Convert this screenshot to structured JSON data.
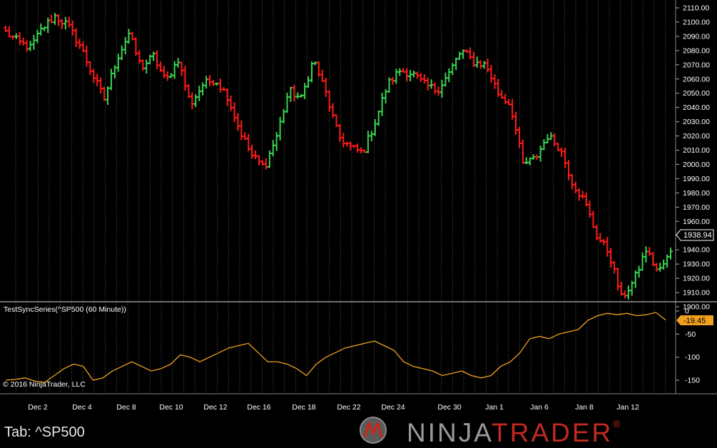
{
  "colors": {
    "background": "#000000",
    "up_bar": "#39d353",
    "down_bar": "#ff1a1a",
    "indicator_line": "#f0a020",
    "separator": "#dddddd",
    "grid": "#6a6a6a",
    "brand_red": "#c02a1f",
    "brand_gray": "#9a9a9a"
  },
  "price_panel": {
    "current_price_label": "1938.94"
  },
  "indicator_panel": {
    "title": "TestSyncSeries(^SP500 (60 Minute))",
    "current_value_label": "-19.45",
    "copyright": "© 2016 NinjaTrader, LLC"
  },
  "footer": {
    "tab_label": "Tab: ^SP500",
    "brand_ninja": "NINJA",
    "brand_trader": "TRADER",
    "brand_reg": "®",
    "logo_icon": "ninjatrader-logo-icon"
  },
  "chart_data": [
    {
      "type": "ohlc",
      "instrument": "^SP500",
      "timeframe": "60 Minute",
      "ylim": [
        1892,
        2116
      ],
      "y_ticks": [
        1900,
        1910,
        1920,
        1930,
        1940,
        1950,
        1960,
        1970,
        1980,
        1990,
        2000,
        2010,
        2020,
        2030,
        2040,
        2050,
        2060,
        2070,
        2080,
        2090,
        2100,
        2110
      ],
      "x_tick_labels": [
        "Dec 2",
        "Dec 4",
        "Dec 8",
        "Dec 10",
        "Dec 12",
        "Dec 16",
        "Dec 18",
        "Dec 22",
        "Dec 24",
        "Dec 30",
        "Jan 1",
        "Jan 6",
        "Jan 8",
        "Jan 12"
      ],
      "last_price": 1938.94,
      "close_anchors": [
        2093,
        2086,
        2082,
        2096,
        2104,
        2098,
        2084,
        2064,
        2046,
        2074,
        2092,
        2068,
        2076,
        2058,
        2074,
        2042,
        2056,
        2060,
        2048,
        2024,
        2006,
        1998,
        2020,
        2052,
        2046,
        2074,
        2050,
        2020,
        2012,
        2008,
        2030,
        2056,
        2066,
        2064,
        2056,
        2052,
        2064,
        2080,
        2072,
        2070,
        2050,
        2042,
        2000,
        2004,
        2020,
        2012,
        1988,
        1974,
        1950,
        1938,
        1906,
        1918,
        1940,
        1924,
        1938
      ]
    },
    {
      "type": "line",
      "series": [
        {
          "name": "TestSyncSeries(^SP500 (60 Minute))"
        }
      ],
      "ylim": [
        -170,
        10
      ],
      "y_ticks": [
        0,
        -50,
        -100,
        -150
      ],
      "last_value": -19.45,
      "values": [
        -150,
        -148,
        -145,
        -152,
        -155,
        -140,
        -125,
        -115,
        -120,
        -150,
        -145,
        -130,
        -120,
        -110,
        -120,
        -130,
        -125,
        -115,
        -95,
        -100,
        -110,
        -100,
        -90,
        -80,
        -75,
        -70,
        -90,
        -110,
        -110,
        -115,
        -125,
        -140,
        -115,
        -100,
        -90,
        -80,
        -75,
        -70,
        -65,
        -75,
        -85,
        -110,
        -120,
        -125,
        -130,
        -140,
        -135,
        -130,
        -140,
        -145,
        -140,
        -120,
        -110,
        -90,
        -60,
        -55,
        -60,
        -50,
        -45,
        -40,
        -20,
        -10,
        -5,
        -8,
        -5,
        -10,
        -8,
        -3,
        -19.45
      ]
    }
  ]
}
